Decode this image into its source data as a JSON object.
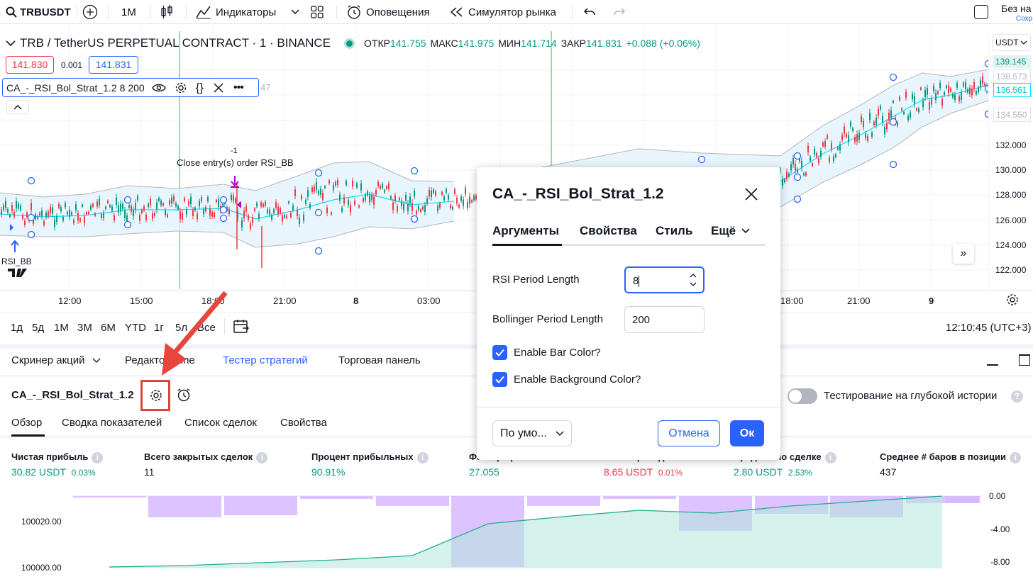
{
  "toolbar": {
    "symbol": "TRBUSDT",
    "interval": "1M",
    "indicators": "Индикаторы",
    "alerts": "Оповещения",
    "replay": "Симулятор рынка",
    "layout_name": "Без на",
    "save": "Сохр"
  },
  "legend": {
    "title": "TRB / TetherUS PERPETUAL CONTRACT · 1 · BINANCE",
    "open_l": "ОТКР",
    "open": "141.755",
    "high_l": "МАКС",
    "high": "141.975",
    "low_l": "МИН",
    "low": "141.714",
    "close_l": "ЗАКР",
    "close": "141.831",
    "change": "+0.088 (+0.06%)",
    "bid": "141.830",
    "spread": "0.001",
    "ask": "141.831",
    "indicator": "CA_-_RSI_Bol_Strat_1.2",
    "ind_params": "8 200",
    "ind_tail": "47",
    "currency": "USDT"
  },
  "price_axis": [
    {
      "label": "139.145",
      "style": "green"
    },
    {
      "label": "138.573",
      "style": "gray"
    },
    {
      "label": "136.561",
      "style": "cyan"
    },
    {
      "label": "134.550",
      "style": "gray"
    },
    {
      "label": "132.000"
    },
    {
      "label": "130.000"
    },
    {
      "label": "128.000"
    },
    {
      "label": "126.000"
    },
    {
      "label": "124.000"
    },
    {
      "label": "122.000"
    }
  ],
  "time_axis": [
    "12:00",
    "15:00",
    "18:00",
    "21:00",
    "8",
    "03:00",
    "18:00",
    "21:00",
    "9"
  ],
  "markers": {
    "close_label": "Close entry(s) order RSI_BB",
    "qty": "-1",
    "entry_label": "RSI_BB"
  },
  "periods": [
    "1д",
    "5д",
    "1М",
    "3М",
    "6М",
    "YTD",
    "1г",
    "5л",
    "Все"
  ],
  "clock": "12:10:45 (UTC+3)",
  "panel": {
    "tabs": [
      "Скринер акций",
      "Редактор Pine",
      "Тестер стратегий",
      "Торговая панель"
    ],
    "strategy": "CA_-_RSI_Bol_Strat_1.2",
    "deep": "Тестирование на глубокой истории",
    "subtabs": [
      "Обзор",
      "Сводка показателей",
      "Список сделок",
      "Свойства"
    ]
  },
  "kpis": [
    {
      "label": "Чистая прибыль",
      "value": "30.82 USDT",
      "pct": "0.03%",
      "color": "green"
    },
    {
      "label": "Всего закрытых сделок",
      "value": "11",
      "pct": "",
      "color": "dark"
    },
    {
      "label": "Процент прибыльных",
      "value": "90.91%",
      "pct": "",
      "color": "green"
    },
    {
      "label": "Фактор прибыли",
      "value": "27.055",
      "pct": "",
      "color": "green"
    },
    {
      "label": "Макс. просадка",
      "value": "8.65 USDT",
      "pct": "0.01%",
      "color": "red"
    },
    {
      "label": "Средняя по сделке",
      "value": "2.80 USDT",
      "pct": "2.53%",
      "color": "green"
    },
    {
      "label": "Среднее # баров в позиции",
      "value": "437",
      "pct": "",
      "color": "dark"
    }
  ],
  "equity_axis": {
    "left": [
      "100020.00",
      "100000.00"
    ],
    "right": [
      "0.00",
      "-4.00",
      "-8.00"
    ]
  },
  "dialog": {
    "title": "CA_-_RSI_Bol_Strat_1.2",
    "tabs": [
      "Аргументы",
      "Свойства",
      "Стиль",
      "Ещё"
    ],
    "rsi_label": "RSI Period Length",
    "rsi_value": "8",
    "bb_label": "Bollinger Period Length",
    "bb_value": "200",
    "bar_color": "Enable Bar Color?",
    "bg_color": "Enable Background Color?",
    "defaults": "По умо...",
    "cancel": "Отмена",
    "ok": "Ок"
  },
  "colors": {
    "accent": "#2962ff",
    "up": "#089981",
    "down": "#f23645",
    "band": "#e3f2fd",
    "basis": "#00e5ff",
    "drawdown": "#d1b3ff",
    "arrow": "#e8453c"
  }
}
